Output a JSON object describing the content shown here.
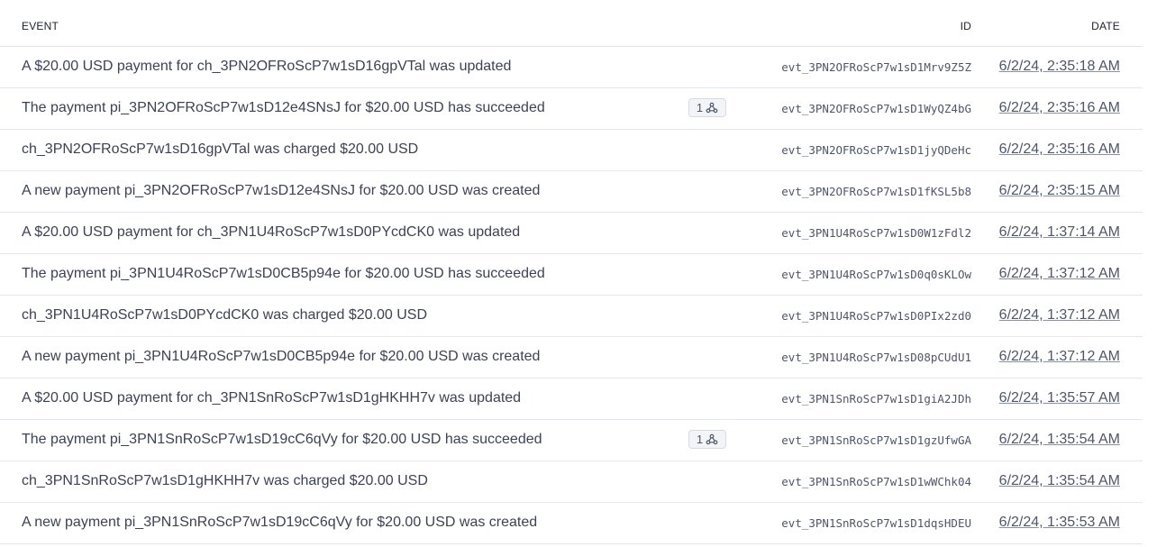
{
  "table": {
    "columns": {
      "event": "EVENT",
      "id": "ID",
      "date": "DATE"
    },
    "rows": [
      {
        "event": "A $20.00 USD payment for ch_3PN2OFRoScP7w1sD16gpVTal was updated",
        "webhook_count": "",
        "id": "evt_3PN2OFRoScP7w1sD1Mrv9Z5Z",
        "date": "6/2/24, 2:35:18 AM"
      },
      {
        "event": "The payment pi_3PN2OFRoScP7w1sD12e4SNsJ for $20.00 USD has succeeded",
        "webhook_count": "1",
        "id": "evt_3PN2OFRoScP7w1sD1WyQZ4bG",
        "date": "6/2/24, 2:35:16 AM"
      },
      {
        "event": "ch_3PN2OFRoScP7w1sD16gpVTal was charged $20.00 USD",
        "webhook_count": "",
        "id": "evt_3PN2OFRoScP7w1sD1jyQDeHc",
        "date": "6/2/24, 2:35:16 AM"
      },
      {
        "event": "A new payment pi_3PN2OFRoScP7w1sD12e4SNsJ for $20.00 USD was created",
        "webhook_count": "",
        "id": "evt_3PN2OFRoScP7w1sD1fKSL5b8",
        "date": "6/2/24, 2:35:15 AM"
      },
      {
        "event": "A $20.00 USD payment for ch_3PN1U4RoScP7w1sD0PYcdCK0 was updated",
        "webhook_count": "",
        "id": "evt_3PN1U4RoScP7w1sD0W1zFdl2",
        "date": "6/2/24, 1:37:14 AM"
      },
      {
        "event": "The payment pi_3PN1U4RoScP7w1sD0CB5p94e for $20.00 USD has succeeded",
        "webhook_count": "",
        "id": "evt_3PN1U4RoScP7w1sD0q0sKLOw",
        "date": "6/2/24, 1:37:12 AM"
      },
      {
        "event": "ch_3PN1U4RoScP7w1sD0PYcdCK0 was charged $20.00 USD",
        "webhook_count": "",
        "id": "evt_3PN1U4RoScP7w1sD0PIx2zd0",
        "date": "6/2/24, 1:37:12 AM"
      },
      {
        "event": "A new payment pi_3PN1U4RoScP7w1sD0CB5p94e for $20.00 USD was created",
        "webhook_count": "",
        "id": "evt_3PN1U4RoScP7w1sD08pCUdU1",
        "date": "6/2/24, 1:37:12 AM"
      },
      {
        "event": "A $20.00 USD payment for ch_3PN1SnRoScP7w1sD1gHKHH7v was updated",
        "webhook_count": "",
        "id": "evt_3PN1SnRoScP7w1sD1giA2JDh",
        "date": "6/2/24, 1:35:57 AM"
      },
      {
        "event": "The payment pi_3PN1SnRoScP7w1sD19cC6qVy for $20.00 USD has succeeded",
        "webhook_count": "1",
        "id": "evt_3PN1SnRoScP7w1sD1gzUfwGA",
        "date": "6/2/24, 1:35:54 AM"
      },
      {
        "event": "ch_3PN1SnRoScP7w1sD1gHKHH7v was charged $20.00 USD",
        "webhook_count": "",
        "id": "evt_3PN1SnRoScP7w1sD1wWChk04",
        "date": "6/2/24, 1:35:54 AM"
      },
      {
        "event": "A new payment pi_3PN1SnRoScP7w1sD19cC6qVy for $20.00 USD was created",
        "webhook_count": "",
        "id": "evt_3PN1SnRoScP7w1sD1dqsHDEU",
        "date": "6/2/24, 1:35:53 AM"
      }
    ],
    "badge_icon": "webhook-icon"
  },
  "colors": {
    "text": "#3c4257",
    "header_text": "#1a1f36",
    "divider": "#e3e8ee",
    "badge_bg": "#f2f4f7"
  }
}
